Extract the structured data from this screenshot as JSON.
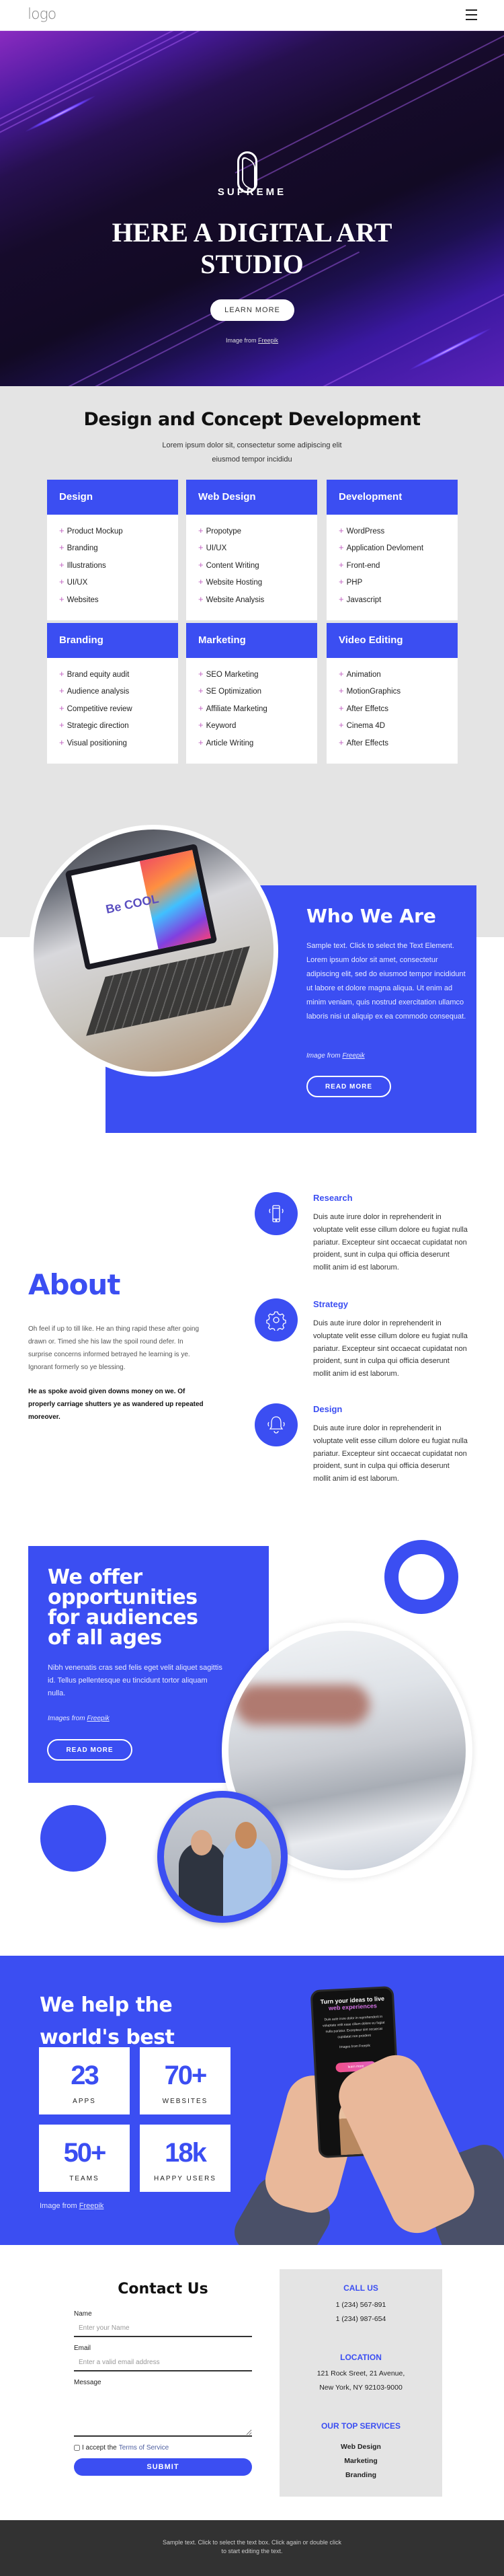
{
  "header": {
    "logo": "logo",
    "menu_icon": "hamburger-icon"
  },
  "hero": {
    "brand": "SUPREME",
    "title_line1": "HERE A DIGITAL ART",
    "title_line2": "STUDIO",
    "button": "LEARN MORE",
    "credit_prefix": "Image from",
    "credit_link": "Freepik"
  },
  "services": {
    "title": "Design and Concept Development",
    "subtitle": "Lorem ipsum dolor sit, consectetur some adipiscing elit eiusmod tempor incididu",
    "cards": [
      {
        "title": "Design",
        "items": [
          "Product Mockup",
          "Branding",
          "Illustrations",
          "UI/UX",
          "Websites"
        ]
      },
      {
        "title": "Web Design",
        "items": [
          "Propotype",
          "UI/UX",
          "Content Writing",
          "Website Hosting",
          "Website Analysis"
        ]
      },
      {
        "title": "Development",
        "items": [
          "WordPress",
          "Application Devloment",
          "Front-end",
          "PHP",
          "Javascript"
        ]
      },
      {
        "title": "Branding",
        "items": [
          "Brand equity audit",
          "Audience analysis",
          "Competitive review",
          "Strategic direction",
          "Visual positioning"
        ]
      },
      {
        "title": "Marketing",
        "items": [
          "SEO Marketing",
          "SE Optimization",
          "Affiliate Marketing",
          "Keyword",
          "Article Writing"
        ]
      },
      {
        "title": "Video Editing",
        "items": [
          "Animation",
          "MotionGraphics",
          "After Effetcs",
          "Cinema 4D",
          "After Effects"
        ]
      }
    ]
  },
  "who": {
    "laptop_screen_text": "Be COOL",
    "title": "Who We Are",
    "text": "Sample text. Click to select the Text Element. Lorem ipsum dolor sit amet, consectetur adipiscing elit, sed do eiusmod tempor incididunt ut labore et dolore magna aliqua. Ut enim ad minim veniam, quis nostrud exercitation ullamco laboris nisi ut aliquip ex ea commodo consequat.",
    "credit_prefix": "Image from",
    "credit_link": "Freepik",
    "button": "READ MORE"
  },
  "about": {
    "title": "About",
    "p1": "Oh feel if up to till like. He an thing rapid these after going drawn or. Timed she his law the spoil round defer. In surprise concerns informed betrayed he learning is ye. Ignorant formerly so ye blessing.",
    "p2": "He as spoke avoid given downs money on we. Of properly carriage shutters ye as wandered up repeated moreover.",
    "features": [
      {
        "title": "Research",
        "icon": "smartphone-vibrate-icon",
        "text": "Duis aute irure dolor in reprehenderit in voluptate velit esse cillum dolore eu fugiat nulla pariatur. Excepteur sint occaecat cupidatat non proident, sunt in culpa qui officia deserunt mollit anim id est laborum."
      },
      {
        "title": "Strategy",
        "icon": "gear-icon",
        "text": "Duis aute irure dolor in reprehenderit in voluptate velit esse cillum dolore eu fugiat nulla pariatur. Excepteur sint occaecat cupidatat non proident, sunt in culpa qui officia deserunt mollit anim id est laborum."
      },
      {
        "title": "Design",
        "icon": "bell-ringing-icon",
        "text": "Duis aute irure dolor in reprehenderit in voluptate velit esse cillum dolore eu fugiat nulla pariatur. Excepteur sint occaecat cupidatat non proident, sunt in culpa qui officia deserunt mollit anim id est laborum."
      }
    ]
  },
  "offer": {
    "title": "We offer opportunities for audiences of all ages",
    "text": "Nibh venenatis cras sed felis eget velit aliquet sagittis id. Tellus pellentesque eu tincidunt tortor aliquam nulla.",
    "credit_prefix": "Images from",
    "credit_link": "Freepik",
    "button": "READ MORE"
  },
  "brands": {
    "title": "We help the world's best brands",
    "stats": [
      {
        "value": "23",
        "label": "APPS"
      },
      {
        "value": "70+",
        "label": "WEBSITES"
      },
      {
        "value": "50+",
        "label": "TEAMS"
      },
      {
        "value": "18k",
        "label": "HAPPY USERS"
      }
    ],
    "credit_prefix": "Image from",
    "credit_link": "Freepik",
    "phone": {
      "line1": "Turn your ideas to live",
      "line2": "web experiences",
      "body": "Duis aute irure dolor in reprehenderit in voluptate velit esse cillum dolore eu fugiat nulla pariatur. Excepteur sint occaecat cupidatat non proident",
      "credit": "Images from Freepik",
      "button": "learn more"
    }
  },
  "contact": {
    "title": "Contact Us",
    "name_label": "Name",
    "name_placeholder": "Enter your Name",
    "email_label": "Email",
    "email_placeholder": "Enter a valid email address",
    "message_label": "Message",
    "terms_prefix": "I accept the",
    "terms_link": "Terms of Service",
    "submit": "SUBMIT",
    "info": {
      "call_title": "CALL US",
      "phone1": "1 (234) 567-891",
      "phone2": "1 (234) 987-654",
      "location_title": "LOCATION",
      "address1": "121 Rock Sreet, 21 Avenue,",
      "address2": "New York, NY 92103-9000",
      "services_title": "OUR TOP SERVICES",
      "services": [
        "Web Design",
        "Marketing",
        "Branding"
      ]
    }
  },
  "footer": {
    "text": "Sample text. Click to select the text box. Click again or double click to start editing the text."
  },
  "colors": {
    "accent": "#3b4ef2",
    "section_grey": "#e4e4e4",
    "footer": "#323232"
  }
}
